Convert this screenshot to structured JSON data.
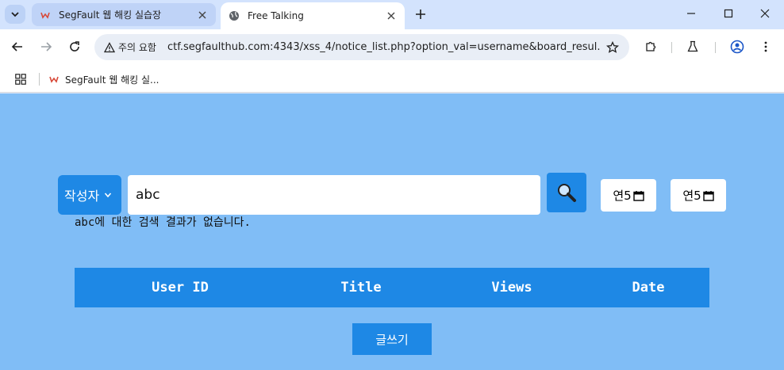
{
  "browser": {
    "tabs": [
      {
        "title": "SegFault 웹 해킹 실습장",
        "favicon": "segfault-logo-icon",
        "active": false
      },
      {
        "title": "Free Talking",
        "favicon": "globe-icon",
        "active": true
      }
    ],
    "security_label": "주의 요함",
    "url": "ctf.segfaulthub.com:4343/xss_4/notice_list.php?option_val=username&board_resul...",
    "bookmarks": [
      {
        "label": "SegFault 웹 해킹 실...",
        "favicon": "segfault-logo-icon"
      }
    ]
  },
  "search": {
    "filter_selected": "작성자",
    "query": "abc",
    "date_from_label": "연5",
    "date_to_label": "연5",
    "no_result_message": "abc에 대한 검색 결과가 없습니다."
  },
  "table": {
    "columns": [
      "User ID",
      "Title",
      "Views",
      "Date"
    ],
    "rows": []
  },
  "actions": {
    "write_label": "글쓰기"
  },
  "colors": {
    "page_background": "#80bdf6",
    "accent": "#1e88e5",
    "tabstrip": "#d3e3fd"
  }
}
